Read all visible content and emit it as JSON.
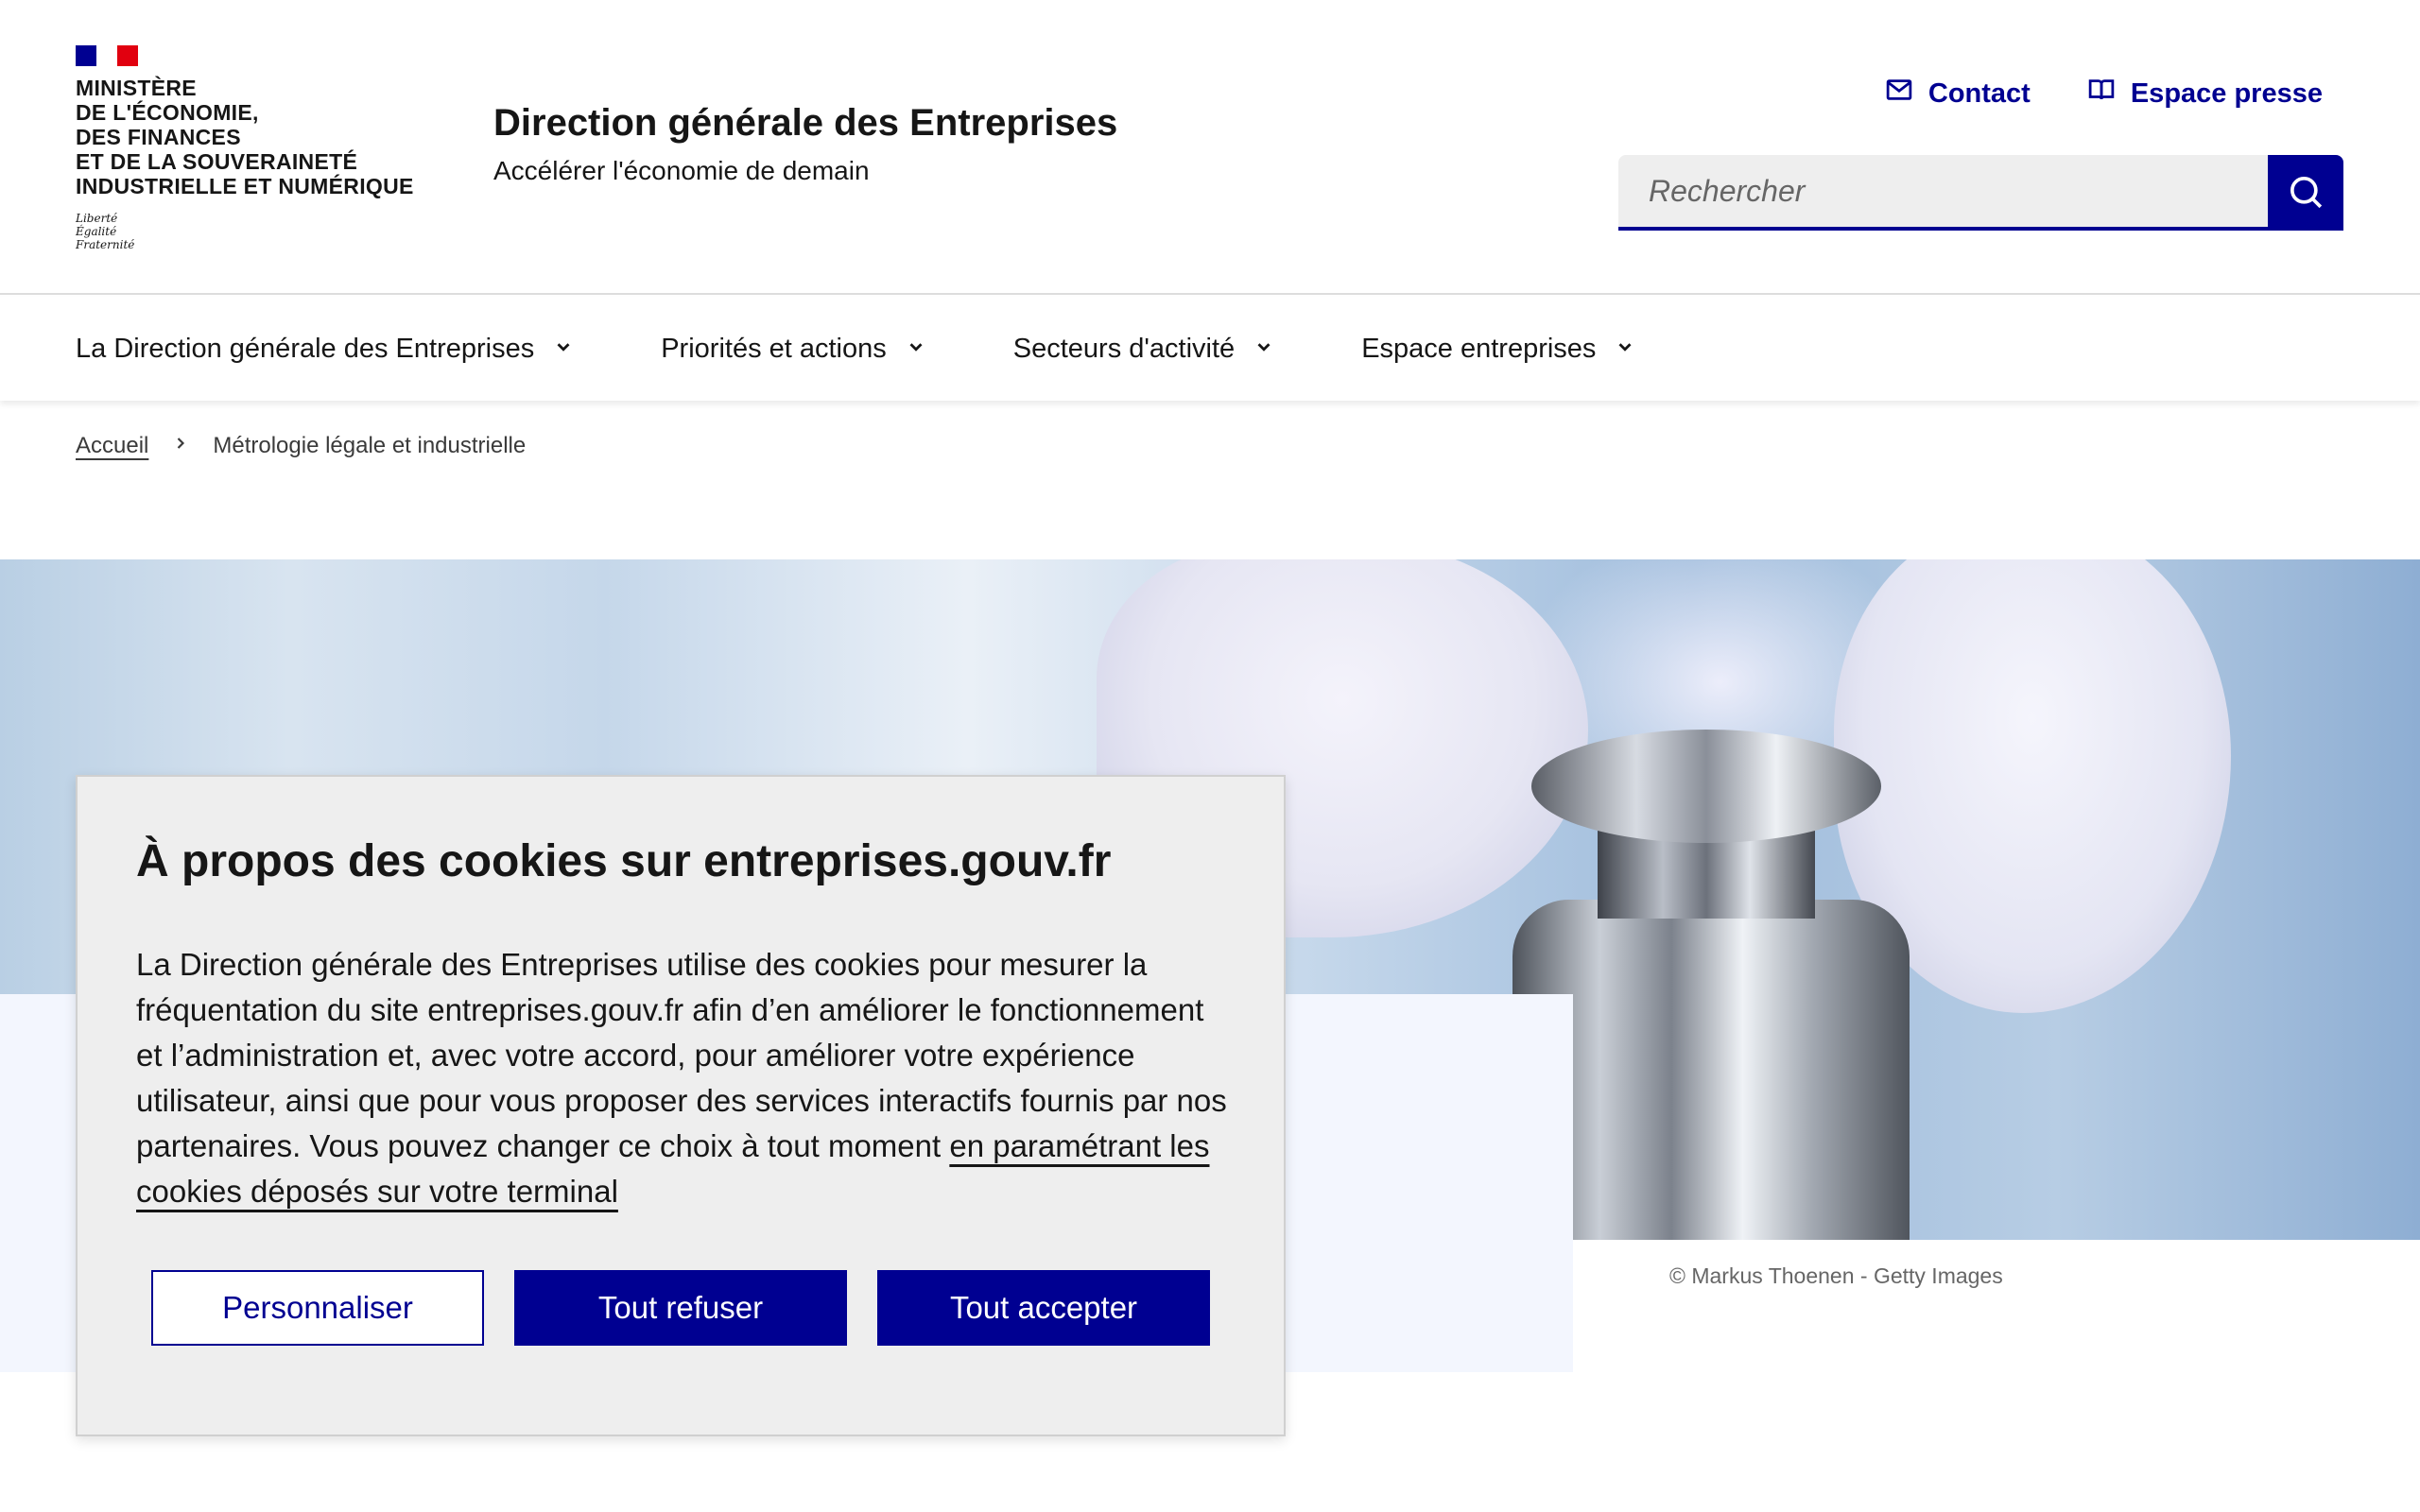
{
  "header": {
    "ministry_lines": [
      "Ministère",
      "de l'économie,",
      "des finances",
      "et de la souveraineté",
      "industrielle et numérique"
    ],
    "devise": [
      "Liberté",
      "Égalité",
      "Fraternité"
    ],
    "site_title": "Direction générale des Entreprises",
    "tagline": "Accélérer l'économie de demain",
    "tools": {
      "contact": "Contact",
      "press": "Espace presse"
    },
    "search": {
      "placeholder": "Rechercher"
    }
  },
  "nav": {
    "items": [
      {
        "label": "La Direction générale des Entreprises"
      },
      {
        "label": "Priorités et actions"
      },
      {
        "label": "Secteurs d'activité"
      },
      {
        "label": "Espace entreprises"
      }
    ]
  },
  "breadcrumb": {
    "home": "Accueil",
    "current": "Métrologie légale et industrielle"
  },
  "hero": {
    "caption": "© Markus Thoenen - Getty Images"
  },
  "consent": {
    "title": "À propos des cookies sur entreprises.gouv.fr",
    "text": "La Direction générale des Entreprises utilise des cookies pour mesurer la fréquentation du site entreprises.gouv.fr afin d’en améliorer le fonctionnement et l’administration et, avec votre accord, pour améliorer votre expérience utilisateur, ainsi que pour vous proposer des services interactifs fournis par nos partenaires. Vous pouvez changer ce choix à tout moment",
    "link": "en paramétrant les cookies déposés sur votre terminal",
    "buttons": {
      "customize": "Personnaliser",
      "refuse": "Tout refuser",
      "accept": "Tout accepter"
    }
  },
  "colors": {
    "primary": "#000091",
    "red": "#e1000f",
    "panel": "#eeeeee",
    "hero_panel": "#f3f6fe"
  }
}
